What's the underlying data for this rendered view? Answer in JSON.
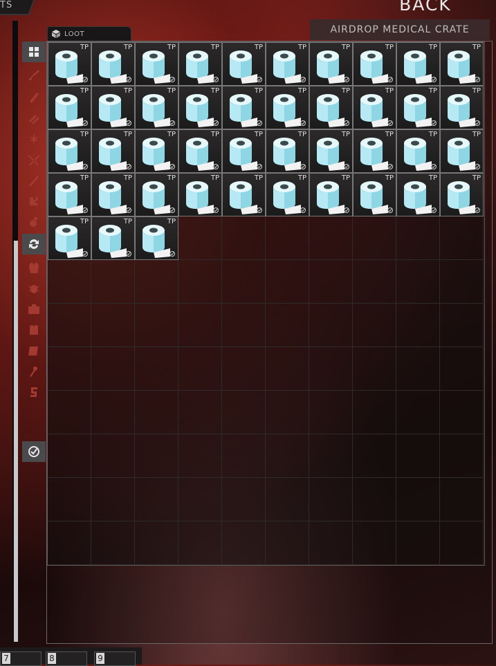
{
  "top_tab": {
    "label": "TS"
  },
  "back_label": "BACK",
  "loot_tab": {
    "label": "LOOT",
    "icon": "box-icon"
  },
  "container": {
    "title": "AIRDROP MEDICAL CRATE",
    "columns": 10,
    "rows": 12
  },
  "item": {
    "short_name": "TP",
    "icon": "toilet-paper-icon",
    "status_icon": "check-circle-icon",
    "count": 43
  },
  "categories": [
    {
      "id": "all",
      "icon": "grid-icon",
      "active": true
    },
    {
      "id": "weapons",
      "icon": "rifle-icon",
      "active": false
    },
    {
      "id": "magazines",
      "icon": "magazine-icon",
      "active": false
    },
    {
      "id": "ammo",
      "icon": "ammo-icon",
      "active": false
    },
    {
      "id": "medical",
      "icon": "medical-star-icon",
      "active": false
    },
    {
      "id": "melee",
      "icon": "crossed-knives-icon",
      "active": false
    },
    {
      "id": "barter",
      "icon": "pencil-icon",
      "active": false
    },
    {
      "id": "mods",
      "icon": "puzzle-icon",
      "active": false
    },
    {
      "id": "grenades",
      "icon": "grenade-icon",
      "active": false
    },
    {
      "id": "sort",
      "icon": "swap-icon",
      "active": true
    },
    {
      "id": "gear",
      "icon": "vest-icon",
      "active": false
    },
    {
      "id": "provisions",
      "icon": "bug-icon",
      "active": false
    },
    {
      "id": "containers",
      "icon": "case-icon",
      "active": false
    },
    {
      "id": "armor",
      "icon": "armor-icon",
      "active": false
    },
    {
      "id": "info",
      "icon": "book-icon",
      "active": false
    },
    {
      "id": "keys",
      "icon": "key-icon",
      "active": false
    },
    {
      "id": "money",
      "icon": "currency-icon",
      "active": false
    },
    {
      "id": "quest",
      "icon": "check-circle-icon",
      "active": true
    }
  ],
  "quick_slots": [
    {
      "number": "7"
    },
    {
      "number": "8"
    },
    {
      "number": "9"
    }
  ],
  "colors": {
    "accent_red": "#c0392b",
    "item_cyan": "#a9e6f0",
    "border": "#7a7778"
  }
}
